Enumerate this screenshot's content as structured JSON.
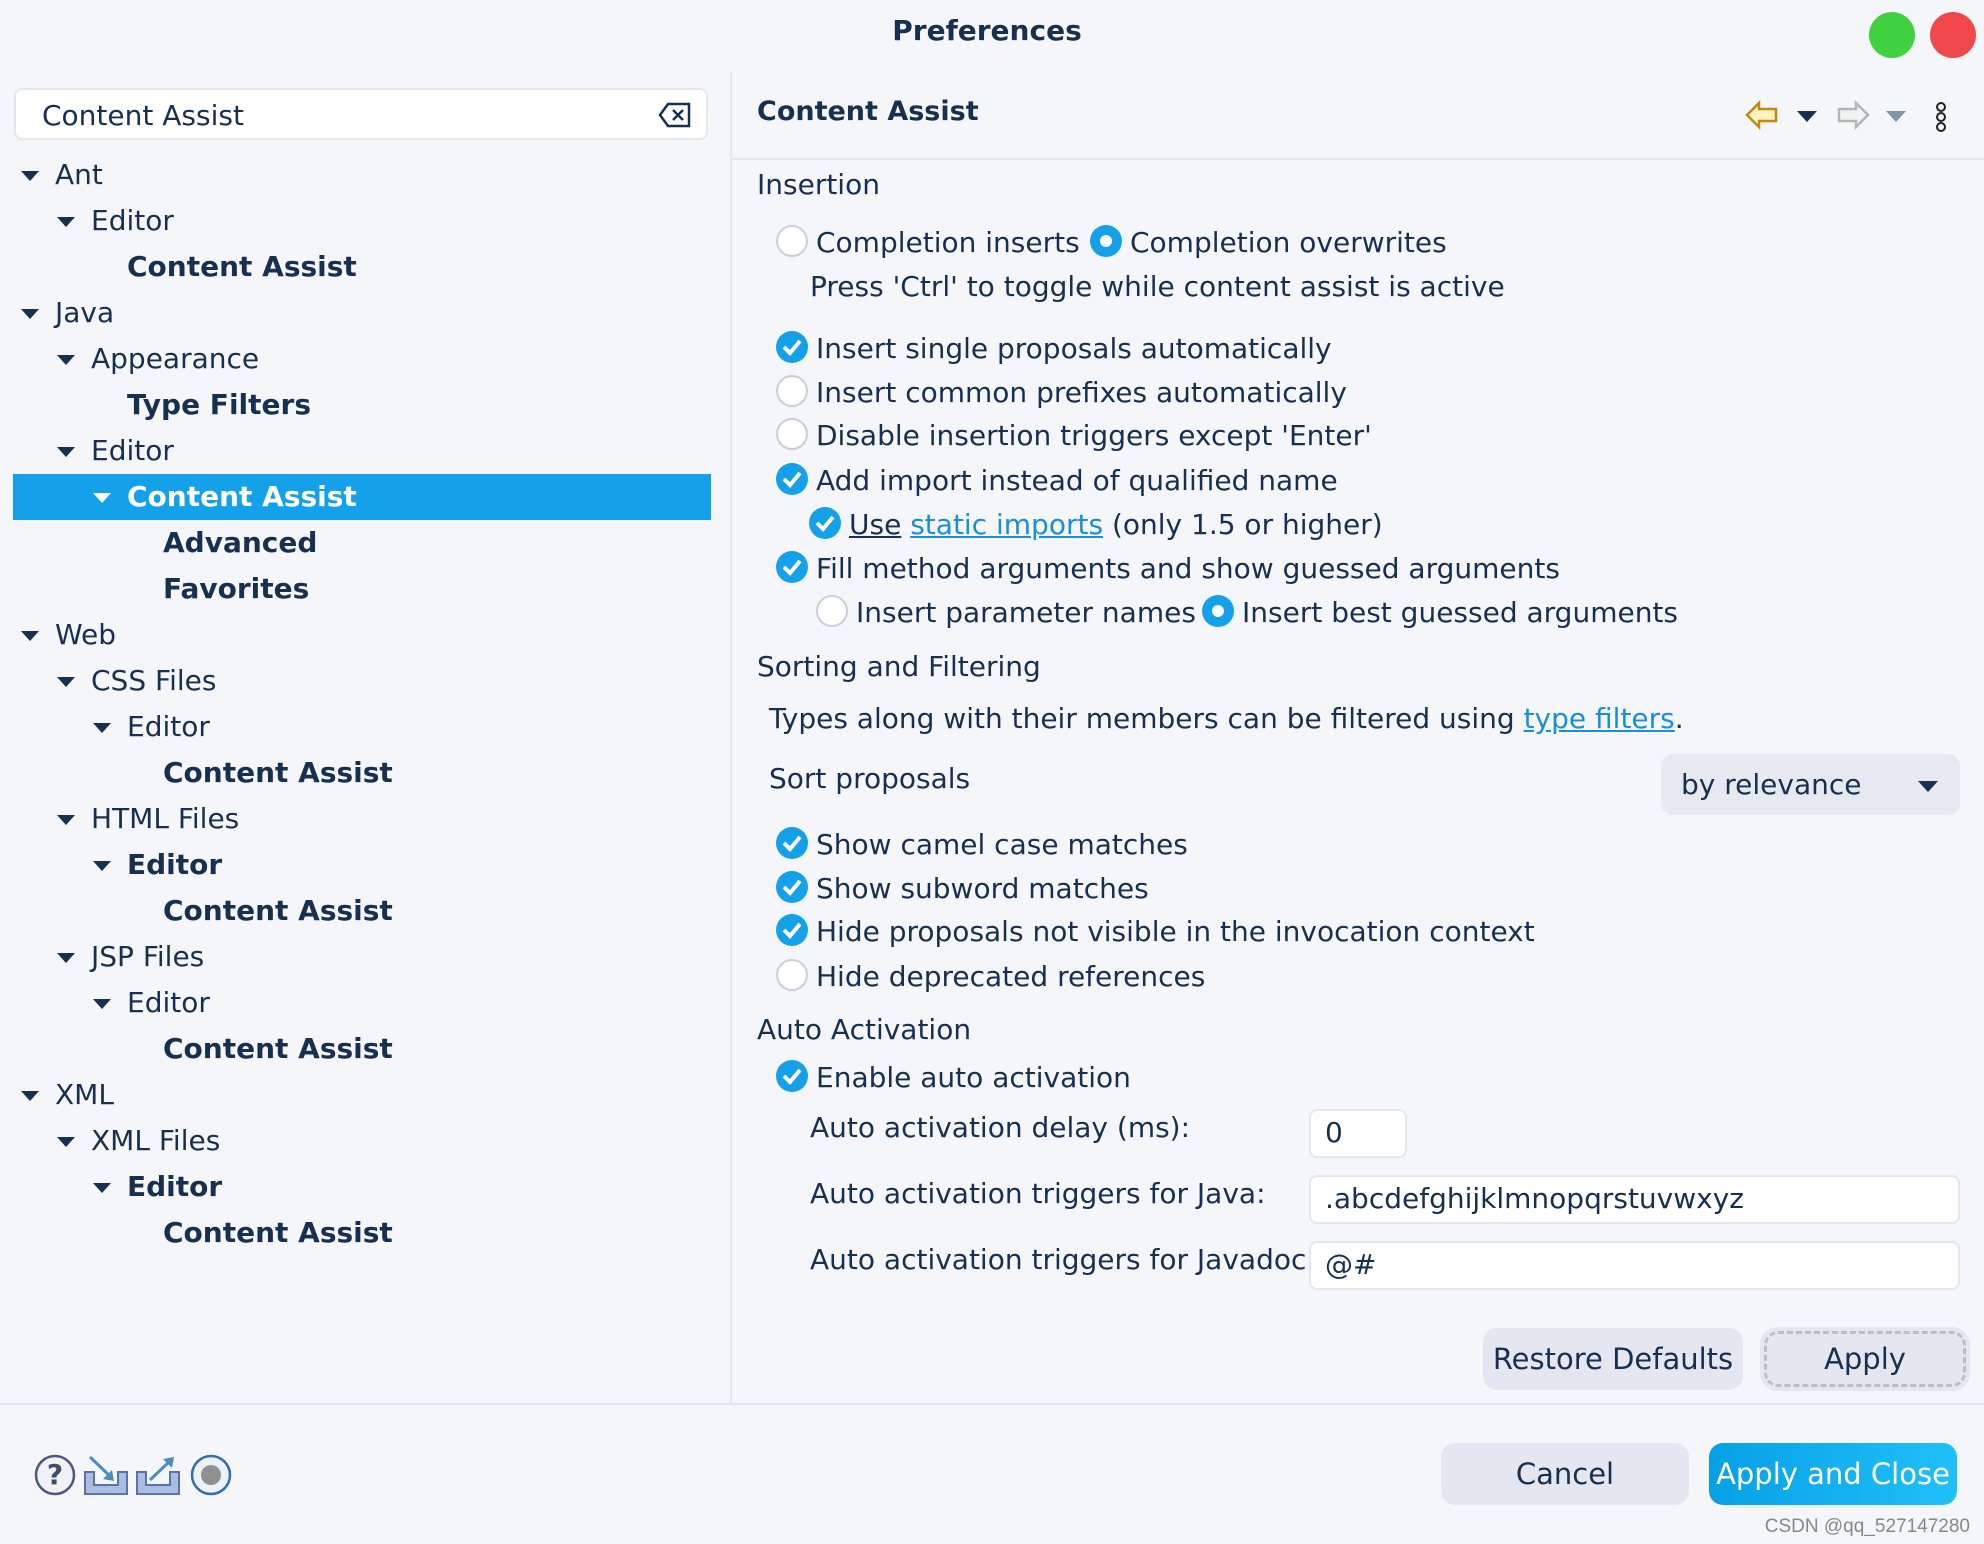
{
  "window": {
    "title": "Preferences",
    "controls": [
      {
        "name": "maximize",
        "color": "#3fd13f"
      },
      {
        "name": "close",
        "color": "#f0474b"
      }
    ]
  },
  "search": {
    "value": "Content Assist",
    "clear_icon": "clear-input-icon"
  },
  "tree": [
    {
      "label": "Ant",
      "level": 0,
      "expanded": true,
      "bold": false
    },
    {
      "label": "Editor",
      "level": 1,
      "expanded": true,
      "bold": false
    },
    {
      "label": "Content Assist",
      "level": 2,
      "bold": true
    },
    {
      "label": "Java",
      "level": 0,
      "expanded": true,
      "bold": false
    },
    {
      "label": "Appearance",
      "level": 1,
      "expanded": true,
      "bold": false
    },
    {
      "label": "Type Filters",
      "level": 2,
      "bold": true
    },
    {
      "label": "Editor",
      "level": 1,
      "expanded": true,
      "bold": false
    },
    {
      "label": "Content Assist",
      "level": 2,
      "expanded": true,
      "bold": true,
      "selected": true
    },
    {
      "label": "Advanced",
      "level": 3,
      "bold": true
    },
    {
      "label": "Favorites",
      "level": 3,
      "bold": true
    },
    {
      "label": "Web",
      "level": 0,
      "expanded": true,
      "bold": false
    },
    {
      "label": "CSS Files",
      "level": 1,
      "expanded": true,
      "bold": false
    },
    {
      "label": "Editor",
      "level": 2,
      "expanded": true,
      "bold": false
    },
    {
      "label": "Content Assist",
      "level": 3,
      "bold": true
    },
    {
      "label": "HTML Files",
      "level": 1,
      "expanded": true,
      "bold": false
    },
    {
      "label": "Editor",
      "level": 2,
      "expanded": true,
      "bold": true
    },
    {
      "label": "Content Assist",
      "level": 3,
      "bold": true
    },
    {
      "label": "JSP Files",
      "level": 1,
      "expanded": true,
      "bold": false
    },
    {
      "label": "Editor",
      "level": 2,
      "expanded": true,
      "bold": false
    },
    {
      "label": "Content Assist",
      "level": 3,
      "bold": true
    },
    {
      "label": "XML",
      "level": 0,
      "expanded": true,
      "bold": false
    },
    {
      "label": "XML Files",
      "level": 1,
      "expanded": true,
      "bold": false
    },
    {
      "label": "Editor",
      "level": 2,
      "expanded": true,
      "bold": true
    },
    {
      "label": "Content Assist",
      "level": 3,
      "bold": true
    }
  ],
  "page": {
    "title": "Content Assist",
    "toolbar": {
      "back_icon": "back-arrow-icon",
      "back_menu_icon": "chevron-down-icon",
      "forward_icon": "forward-arrow-icon",
      "forward_menu_icon": "chevron-down-icon",
      "menu_icon": "vertical-dots-icon"
    },
    "insertion": {
      "heading": "Insertion",
      "mode": [
        {
          "label": "Completion inserts",
          "selected": false
        },
        {
          "label": "Completion overwrites",
          "selected": true
        }
      ],
      "hint": "Press 'Ctrl' to toggle while content assist is active",
      "options": [
        {
          "label": "Insert single proposals automatically",
          "checked": true
        },
        {
          "label": "Insert common prefixes automatically",
          "checked": false
        },
        {
          "label": "Disable insertion triggers except 'Enter'",
          "checked": false
        },
        {
          "label": "Add import instead of qualified name",
          "checked": true
        }
      ],
      "static_imports": {
        "checked": true,
        "prefix": "Use",
        "link": "static imports",
        "suffix": "(only 1.5 or higher)"
      },
      "fill_args": {
        "label": "Fill method arguments and show guessed arguments",
        "checked": true
      },
      "arg_mode": [
        {
          "label": "Insert parameter names",
          "selected": false
        },
        {
          "label": "Insert best guessed arguments",
          "selected": true
        }
      ]
    },
    "sorting": {
      "heading": "Sorting and Filtering",
      "desc": "Types along with their members can be filtered using",
      "desc_link": "type filters",
      "desc_end": ".",
      "sort_label": "Sort proposals",
      "sort_value": "by relevance",
      "options": [
        {
          "label": "Show camel case matches",
          "checked": true
        },
        {
          "label": "Show subword matches",
          "checked": true
        },
        {
          "label": "Hide proposals not visible in the invocation context",
          "checked": true
        },
        {
          "label": "Hide deprecated references",
          "checked": false
        }
      ]
    },
    "auto": {
      "heading": "Auto Activation",
      "enable": {
        "label": "Enable auto activation",
        "checked": true
      },
      "delay_label": "Auto activation delay (ms):",
      "delay_value": "0",
      "java_label": "Auto activation triggers for Java:",
      "java_value": ".abcdefghijklmnopqrstuvwxyz",
      "javadoc_label": "Auto activation triggers for Javadoc:",
      "javadoc_value": "@#"
    },
    "restore_label": "Restore Defaults",
    "apply_label": "Apply"
  },
  "footer": {
    "icons": [
      "help-icon",
      "import-icon",
      "export-icon",
      "record-icon"
    ],
    "cancel_label": "Cancel",
    "apply_close_label": "Apply and Close",
    "accent": "#14a1e9"
  },
  "watermark": "CSDN @qq_527147280"
}
